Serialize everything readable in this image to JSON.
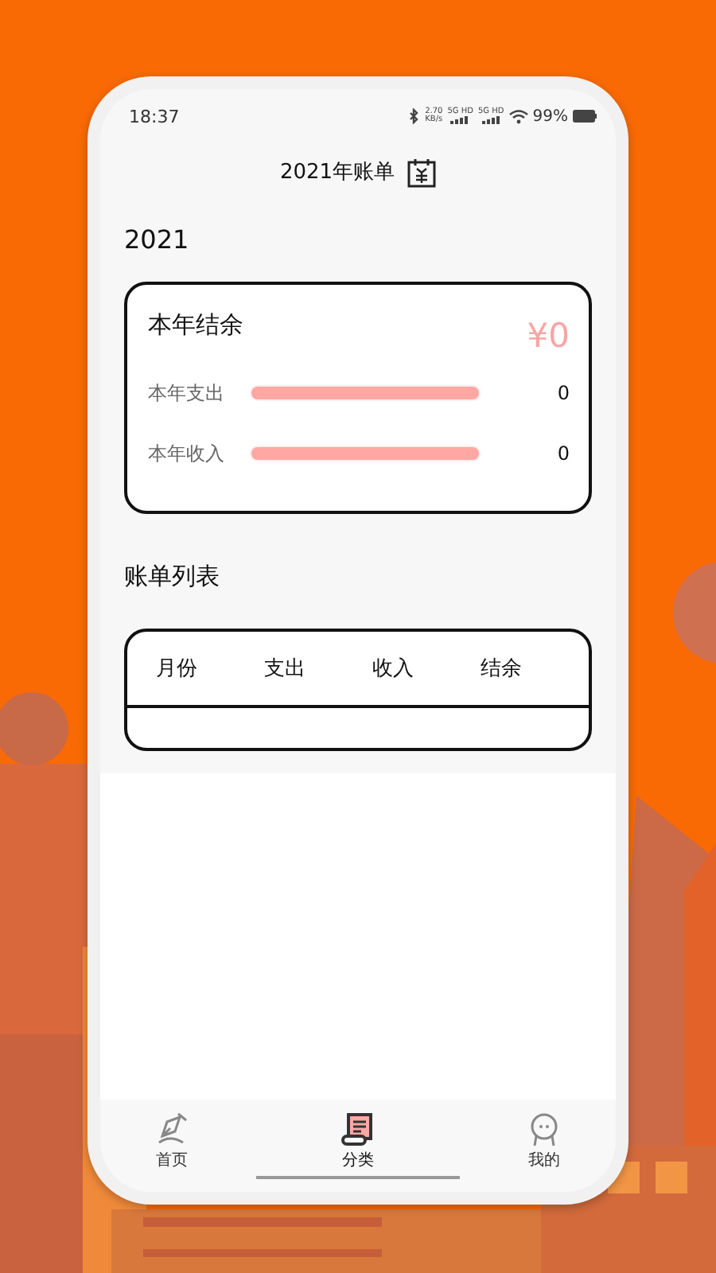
{
  "status_bar": {
    "time": "18:37",
    "speed_value": "2.70",
    "speed_unit": "KB/s",
    "networks": [
      "5G HD",
      "5G HD"
    ],
    "battery": "99%"
  },
  "header": {
    "title": "2021年账单"
  },
  "year": "2021",
  "summary": {
    "title": "本年结余",
    "amount": "¥0",
    "rows": [
      {
        "label": "本年支出",
        "level": 1,
        "value": "0"
      },
      {
        "label": "本年收入",
        "level": 1,
        "value": "0"
      }
    ]
  },
  "list": {
    "title": "账单列表",
    "columns": [
      "月份",
      "支出",
      "收入",
      "结余"
    ]
  },
  "tabs": [
    {
      "label": "首页",
      "selected": false
    },
    {
      "label": "分类",
      "selected": true
    },
    {
      "label": "我的",
      "selected": false
    }
  ]
}
